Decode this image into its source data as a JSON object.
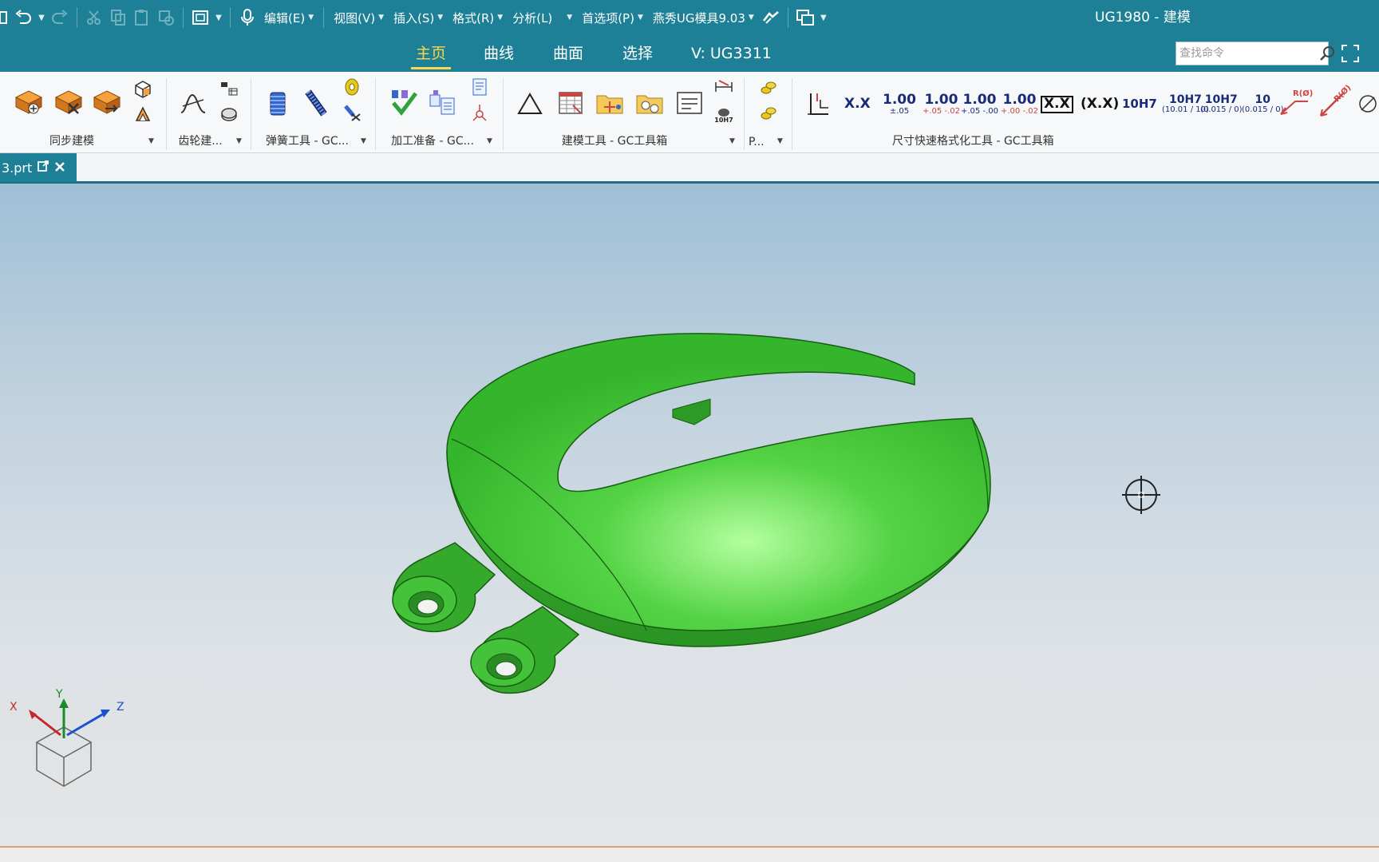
{
  "window": {
    "title": "UG1980 - 建模"
  },
  "menubar": {
    "items": [
      {
        "label": "编辑(E)"
      },
      {
        "label": "视图(V)"
      },
      {
        "label": "插入(S)"
      },
      {
        "label": "格式(R)"
      },
      {
        "label": "分析(L)"
      },
      {
        "label": "首选项(P)"
      },
      {
        "label": "燕秀UG模具9.03"
      }
    ]
  },
  "ribbon_tabs": [
    {
      "label": "主页",
      "active": true
    },
    {
      "label": "曲线",
      "active": false
    },
    {
      "label": "曲面",
      "active": false
    },
    {
      "label": "选择",
      "active": false
    },
    {
      "label": "V:  UG3311",
      "active": false
    }
  ],
  "search": {
    "placeholder": "查找命令",
    "value": ""
  },
  "ribbon_groups": [
    {
      "label": "同步建模"
    },
    {
      "label": "齿轮建..."
    },
    {
      "label": "弹簧工具 - GC..."
    },
    {
      "label": "加工准备 - GC..."
    },
    {
      "label": "建模工具 - GC工具箱"
    },
    {
      "label": "P..."
    },
    {
      "label": "尺寸快速格式化工具 - GC工具箱"
    }
  ],
  "dimension_tools": [
    {
      "main": "X.X",
      "sub": ""
    },
    {
      "main": "1.00",
      "sub": "±.05"
    },
    {
      "main": "1.00",
      "sub": "+.05 -.02"
    },
    {
      "main": "1.00",
      "sub": "+.05 -.00"
    },
    {
      "main": "1.00",
      "sub": "+.00 -.02"
    },
    {
      "main": "X.X",
      "sub": ""
    },
    {
      "main": "(X.X)",
      "sub": ""
    },
    {
      "main": "10H7",
      "sub": ""
    },
    {
      "main": "10H7",
      "sub": "(10.01 / 10)"
    },
    {
      "main": "10H7",
      "sub": "(0.015 / 0)"
    },
    {
      "main": "10",
      "sub": "(0.015 / 0)"
    },
    {
      "main": "R(Ø)",
      "sub": ""
    },
    {
      "main": "R(Ø)",
      "sub": ""
    }
  ],
  "small_labels": {
    "fit_10h7": "10H7"
  },
  "document": {
    "tab_label": "3.prt"
  },
  "triad": {
    "x": "X",
    "y": "Y",
    "z": "Z"
  },
  "colors": {
    "titlebar": "#1e8096",
    "active_tab": "#ffd54a",
    "part_green": "#3fc43a",
    "viewport_top": "#9fbfd7",
    "viewport_bottom": "#e4e5e6"
  }
}
